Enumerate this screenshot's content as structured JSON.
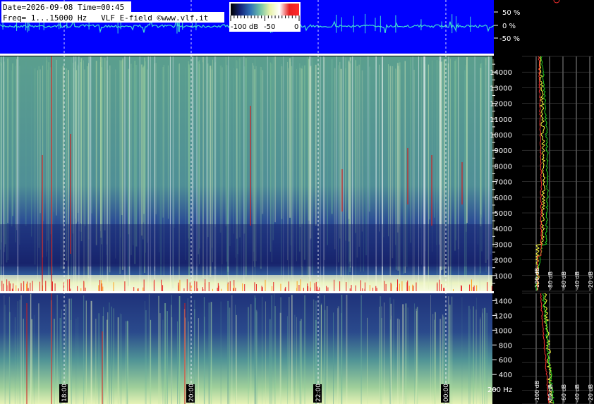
{
  "header": {
    "line1": "Date=2026-09-08 Time=00:45",
    "line2": "Freq= 1...15000 Hz   VLF E-field ©www.vlf.it"
  },
  "colorbar": {
    "labels": [
      "-100 dB",
      "-50",
      "0"
    ],
    "stops": [
      "#000000",
      "#14247a",
      "#2e6fb6",
      "#6fc0a6",
      "#e8f2a8",
      "#ffffff",
      "#e82020",
      "#ff2a2a"
    ]
  },
  "waveform": {
    "background": "#0000ff",
    "trace_color": "#40e0d0",
    "scale_labels": [
      "50 %",
      "0 %",
      "-50 %"
    ]
  },
  "time_axis": {
    "labels": [
      "18:00",
      "20:00",
      "22:00",
      "00:00"
    ]
  },
  "freq_axis_upper": {
    "labels": [
      "14000",
      "13000",
      "12000",
      "11000",
      "10000",
      "9000",
      "8000",
      "7000",
      "6000",
      "5000",
      "4000",
      "3000",
      "2000",
      "1000"
    ]
  },
  "freq_axis_lower": {
    "labels": [
      "1400",
      "1200",
      "1000",
      "800",
      "600",
      "400",
      "200 Hz"
    ]
  },
  "spectrum_panel": {
    "db_labels": [
      "-100 dB",
      "-80 dB",
      "-60 dB",
      "-40 dB",
      "-20 dB"
    ],
    "colors": {
      "yellow": "#ffff40",
      "red": "#ff3030",
      "green": "#20d020",
      "grid": "#ffffff"
    }
  },
  "chart_data": {
    "type": "heatmap",
    "title": "",
    "x_labels": [
      "18:00",
      "20:00",
      "22:00",
      "00:00"
    ],
    "y_upper_range_hz": [
      0,
      15000
    ],
    "y_lower_range_hz": [
      0,
      1500
    ],
    "db_range": [
      -100,
      0
    ],
    "spectrum_db_ticks": [
      -100,
      -80,
      -60,
      -40,
      -20
    ]
  }
}
